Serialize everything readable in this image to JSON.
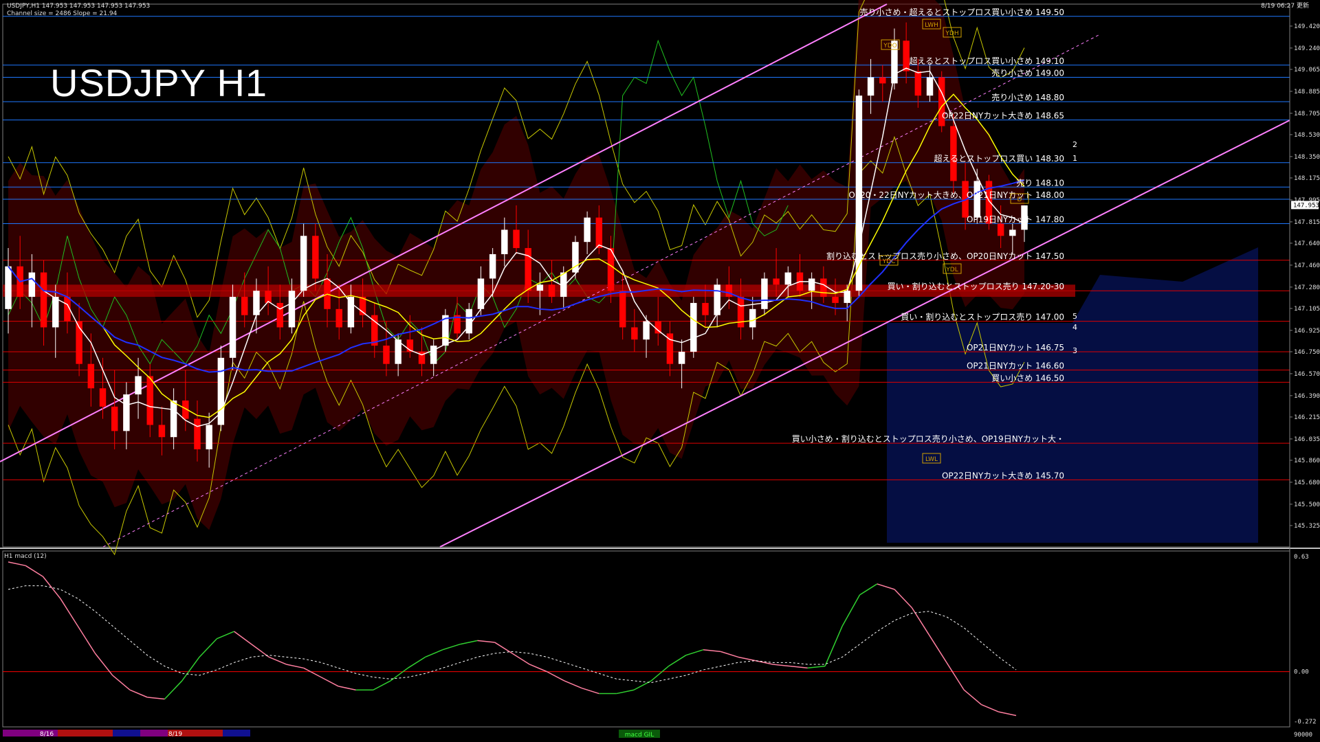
{
  "header": {
    "symbol_line": "USDJPY,H1  147.953 147.953 147.953 147.953",
    "channel_line": "Channel size = 2486  Slope = 21.94",
    "timestamp": "8/19 06:27 更新",
    "title": "USDJPY H1"
  },
  "macd_label": "H1  macd (12)",
  "colors": {
    "background": "#000000",
    "bull_candle": "#ffffff",
    "bear_candle": "#ff0000",
    "ma_fast": "#ffffff",
    "ma_mid": "#ffff00",
    "ma_slow": "#2030ff",
    "channel": "#ff80ff",
    "macd_rise": "#30d030",
    "macd_fall": "#ff7fa0",
    "zero_line": "#ff0000"
  },
  "chart_data": {
    "type": "candlestick",
    "price_axis": {
      "min": 145.15,
      "max": 149.6,
      "ticks": [
        "149.420",
        "149.240",
        "149.065",
        "148.885",
        "148.705",
        "148.530",
        "148.350",
        "148.175",
        "147.995",
        "147.815",
        "147.640",
        "147.460",
        "147.280",
        "147.105",
        "146.925",
        "146.750",
        "146.570",
        "146.390",
        "146.215",
        "146.035",
        "145.860",
        "145.680",
        "145.500",
        "145.325"
      ],
      "current_price": "147.953"
    },
    "levels": [
      {
        "price": 149.5,
        "text": "売り小さめ・超えるとストップロス買い小さめ 149.50",
        "color": "blue"
      },
      {
        "price": 149.1,
        "text": "超えるとストップロス買い小さめ 149.10",
        "color": "blue"
      },
      {
        "price": 149.0,
        "text": "売り小さめ 149.00",
        "color": "blue"
      },
      {
        "price": 148.8,
        "text": "売り小さめ 148.80",
        "color": "blue"
      },
      {
        "price": 148.65,
        "text": "OP22日NYカット大きめ 148.65",
        "color": "blue"
      },
      {
        "price": 148.3,
        "text": "超えるとストップロス買い 148.30",
        "color": "blue"
      },
      {
        "price": 148.1,
        "text": "売り 148.10",
        "color": "blue"
      },
      {
        "price": 148.0,
        "text": "OP20・22日NYカット大きめ、OP21日NYカット 148.00",
        "color": "blue"
      },
      {
        "price": 147.8,
        "text": "OP19日NYカット 147.80",
        "color": "blue"
      },
      {
        "price": 147.5,
        "text": "割り込むとストップロス売り小さめ、OP20日NYカット 147.50",
        "color": "red"
      },
      {
        "price": 147.25,
        "text": "買い・割り込むとストップロス売り 147.20-30",
        "color": "red"
      },
      {
        "price": 147.0,
        "text": "買い・割り込むとストップロス売り 147.00",
        "color": "red"
      },
      {
        "price": 146.75,
        "text": "OP21日NYカット 146.75",
        "color": "red"
      },
      {
        "price": 146.6,
        "text": "OP21日NYカット 146.60",
        "color": "red"
      },
      {
        "price": 146.5,
        "text": "買い小さめ 146.50",
        "color": "red"
      },
      {
        "price": 146.0,
        "text": "買い小さめ・割り込むとストップロス売り小さめ、OP19日NYカット大・",
        "color": "red"
      },
      {
        "price": 145.7,
        "text": "OP22日NYカット大きめ 145.70",
        "color": "red"
      }
    ],
    "markers": [
      "YDH",
      "YDO",
      "YDC",
      "YDL",
      "LWH",
      "LWL",
      "D"
    ],
    "wave_labels": [
      "1",
      "2",
      "3",
      "4",
      "5"
    ],
    "candles": [
      [
        147.1,
        147.6,
        146.9,
        147.45
      ],
      [
        147.45,
        147.7,
        147.1,
        147.2
      ],
      [
        147.2,
        147.55,
        146.95,
        147.4
      ],
      [
        147.4,
        147.5,
        146.8,
        146.95
      ],
      [
        146.95,
        147.3,
        146.7,
        147.2
      ],
      [
        147.2,
        147.4,
        146.9,
        147.0
      ],
      [
        147.0,
        147.15,
        146.55,
        146.65
      ],
      [
        146.65,
        146.9,
        146.3,
        146.45
      ],
      [
        146.45,
        146.7,
        146.2,
        146.3
      ],
      [
        146.3,
        146.6,
        145.95,
        146.1
      ],
      [
        146.1,
        146.5,
        145.95,
        146.4
      ],
      [
        146.4,
        146.7,
        146.2,
        146.55
      ],
      [
        146.55,
        146.65,
        146.05,
        146.15
      ],
      [
        146.15,
        146.3,
        145.9,
        146.05
      ],
      [
        146.05,
        146.45,
        145.95,
        146.35
      ],
      [
        146.35,
        146.6,
        146.1,
        146.2
      ],
      [
        146.2,
        146.35,
        145.85,
        145.95
      ],
      [
        145.95,
        146.25,
        145.8,
        146.15
      ],
      [
        146.15,
        146.8,
        146.1,
        146.7
      ],
      [
        146.7,
        147.3,
        146.6,
        147.2
      ],
      [
        147.2,
        147.4,
        146.95,
        147.05
      ],
      [
        147.05,
        147.35,
        146.9,
        147.25
      ],
      [
        147.25,
        147.45,
        147.05,
        147.15
      ],
      [
        147.15,
        147.3,
        146.85,
        146.95
      ],
      [
        146.95,
        147.35,
        146.9,
        147.25
      ],
      [
        147.25,
        147.8,
        147.2,
        147.7
      ],
      [
        147.7,
        147.8,
        147.25,
        147.35
      ],
      [
        147.35,
        147.55,
        146.95,
        147.1
      ],
      [
        147.1,
        147.3,
        146.85,
        146.95
      ],
      [
        146.95,
        147.3,
        146.9,
        147.2
      ],
      [
        147.2,
        147.35,
        146.95,
        147.05
      ],
      [
        147.05,
        147.15,
        146.7,
        146.8
      ],
      [
        146.8,
        147.0,
        146.55,
        146.65
      ],
      [
        146.65,
        146.9,
        146.55,
        146.85
      ],
      [
        146.85,
        147.05,
        146.7,
        146.75
      ],
      [
        146.75,
        146.95,
        146.55,
        146.65
      ],
      [
        146.65,
        146.85,
        146.55,
        146.8
      ],
      [
        146.8,
        147.1,
        146.75,
        147.05
      ],
      [
        147.05,
        147.2,
        146.85,
        146.9
      ],
      [
        146.9,
        147.15,
        146.85,
        147.1
      ],
      [
        147.1,
        147.45,
        147.05,
        147.35
      ],
      [
        147.35,
        147.6,
        147.2,
        147.55
      ],
      [
        147.55,
        147.85,
        147.45,
        147.75
      ],
      [
        147.75,
        147.95,
        147.55,
        147.6
      ],
      [
        147.6,
        147.75,
        147.15,
        147.25
      ],
      [
        147.25,
        147.4,
        147.05,
        147.3
      ],
      [
        147.3,
        147.5,
        147.15,
        147.2
      ],
      [
        147.2,
        147.45,
        147.1,
        147.4
      ],
      [
        147.4,
        147.7,
        147.35,
        147.65
      ],
      [
        147.65,
        147.9,
        147.55,
        147.85
      ],
      [
        147.85,
        147.95,
        147.55,
        147.6
      ],
      [
        147.6,
        147.7,
        147.15,
        147.25
      ],
      [
        147.25,
        147.4,
        146.85,
        146.95
      ],
      [
        146.95,
        147.1,
        146.75,
        146.85
      ],
      [
        146.85,
        147.05,
        146.7,
        147.0
      ],
      [
        147.0,
        147.2,
        146.8,
        146.9
      ],
      [
        146.9,
        147.0,
        146.55,
        146.65
      ],
      [
        146.65,
        146.85,
        146.45,
        146.75
      ],
      [
        146.75,
        147.2,
        146.7,
        147.15
      ],
      [
        147.15,
        147.3,
        146.95,
        147.05
      ],
      [
        147.05,
        147.35,
        146.95,
        147.3
      ],
      [
        147.3,
        147.45,
        147.1,
        147.2
      ],
      [
        147.2,
        147.35,
        146.85,
        146.95
      ],
      [
        146.95,
        147.2,
        146.85,
        147.1
      ],
      [
        147.1,
        147.4,
        147.05,
        147.35
      ],
      [
        147.35,
        147.6,
        147.2,
        147.3
      ],
      [
        147.3,
        147.45,
        147.2,
        147.4
      ],
      [
        147.4,
        147.55,
        147.2,
        147.25
      ],
      [
        147.25,
        147.4,
        147.1,
        147.35
      ],
      [
        147.35,
        147.45,
        147.15,
        147.2
      ],
      [
        147.2,
        147.35,
        147.05,
        147.15
      ],
      [
        147.15,
        147.3,
        147.0,
        147.25
      ],
      [
        147.25,
        148.9,
        147.2,
        148.85
      ],
      [
        148.85,
        149.15,
        148.7,
        149.0
      ],
      [
        149.0,
        149.1,
        148.8,
        148.95
      ],
      [
        148.95,
        149.4,
        148.9,
        149.3
      ],
      [
        149.3,
        149.45,
        148.95,
        149.05
      ],
      [
        149.05,
        149.15,
        148.75,
        148.85
      ],
      [
        148.85,
        149.1,
        148.8,
        149.0
      ],
      [
        149.0,
        149.05,
        148.55,
        148.6
      ],
      [
        148.6,
        148.7,
        148.05,
        148.15
      ],
      [
        148.15,
        148.3,
        147.75,
        147.85
      ],
      [
        147.85,
        148.25,
        147.8,
        148.15
      ],
      [
        148.15,
        148.2,
        147.75,
        147.8
      ],
      [
        147.8,
        147.95,
        147.6,
        147.7
      ],
      [
        147.7,
        147.8,
        147.55,
        147.75
      ],
      [
        147.75,
        147.95,
        147.65,
        147.95
      ]
    ],
    "macd": {
      "ylim": [
        -0.272,
        0.63
      ],
      "ticks": [
        "0.63",
        "0.00",
        "-0.272"
      ],
      "line": [
        0.6,
        0.58,
        0.52,
        0.4,
        0.25,
        0.1,
        -0.02,
        -0.1,
        -0.14,
        -0.15,
        -0.05,
        0.08,
        0.18,
        0.22,
        0.15,
        0.08,
        0.04,
        0.02,
        -0.03,
        -0.08,
        -0.1,
        -0.1,
        -0.05,
        0.02,
        0.08,
        0.12,
        0.15,
        0.17,
        0.16,
        0.1,
        0.04,
        0.0,
        -0.05,
        -0.09,
        -0.12,
        -0.12,
        -0.1,
        -0.05,
        0.03,
        0.09,
        0.12,
        0.11,
        0.08,
        0.06,
        0.04,
        0.03,
        0.02,
        0.03,
        0.25,
        0.42,
        0.48,
        0.45,
        0.35,
        0.2,
        0.05,
        -0.1,
        -0.18,
        -0.22,
        -0.24
      ],
      "signal": [
        0.45,
        0.47,
        0.47,
        0.45,
        0.4,
        0.33,
        0.25,
        0.17,
        0.09,
        0.03,
        -0.01,
        -0.02,
        0.01,
        0.05,
        0.08,
        0.09,
        0.08,
        0.07,
        0.05,
        0.02,
        -0.01,
        -0.03,
        -0.04,
        -0.03,
        -0.01,
        0.02,
        0.05,
        0.08,
        0.1,
        0.11,
        0.1,
        0.08,
        0.05,
        0.02,
        -0.01,
        -0.04,
        -0.05,
        -0.06,
        -0.04,
        -0.02,
        0.01,
        0.03,
        0.05,
        0.06,
        0.05,
        0.05,
        0.04,
        0.04,
        0.08,
        0.15,
        0.22,
        0.28,
        0.32,
        0.33,
        0.3,
        0.24,
        0.16,
        0.08,
        0.01
      ]
    },
    "time_labels": [
      "8/16",
      "8/19"
    ],
    "footer_tab": "macd GIL",
    "volume_scale": "90000"
  }
}
